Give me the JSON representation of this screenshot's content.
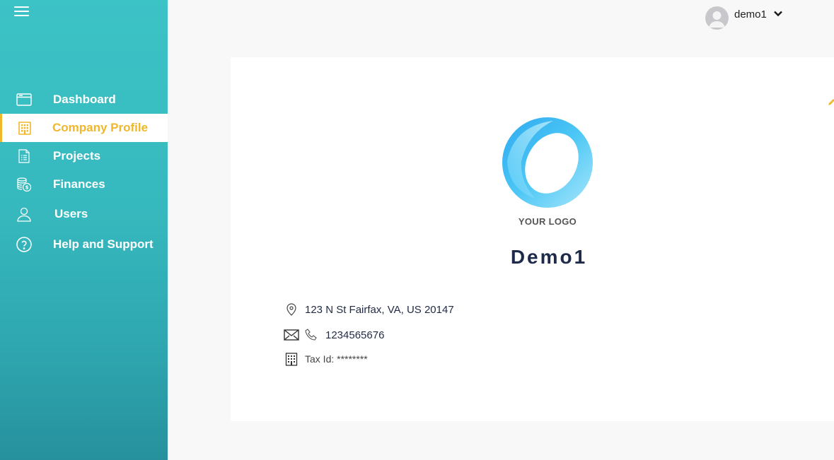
{
  "sidebar": {
    "items": [
      {
        "label": "Dashboard",
        "icon": "dashboard-icon"
      },
      {
        "label": "Company Profile",
        "icon": "building-icon",
        "active": true
      },
      {
        "label": "Projects",
        "icon": "document-icon"
      },
      {
        "label": "Finances",
        "icon": "coins-icon"
      },
      {
        "label": "Users",
        "icon": "user-icon"
      },
      {
        "label": "Help and Support",
        "icon": "help-icon"
      }
    ],
    "active_color": "#f0b72b",
    "gradient_top": "#3cc3c6",
    "gradient_bottom": "#26919d"
  },
  "header": {
    "username": "demo1"
  },
  "company": {
    "logo_text": "YOUR LOGO",
    "name": "Demo1",
    "address": "123 N St Fairfax, VA, US 20147",
    "phone": "1234565676",
    "tax_id": "Tax Id: ********"
  }
}
